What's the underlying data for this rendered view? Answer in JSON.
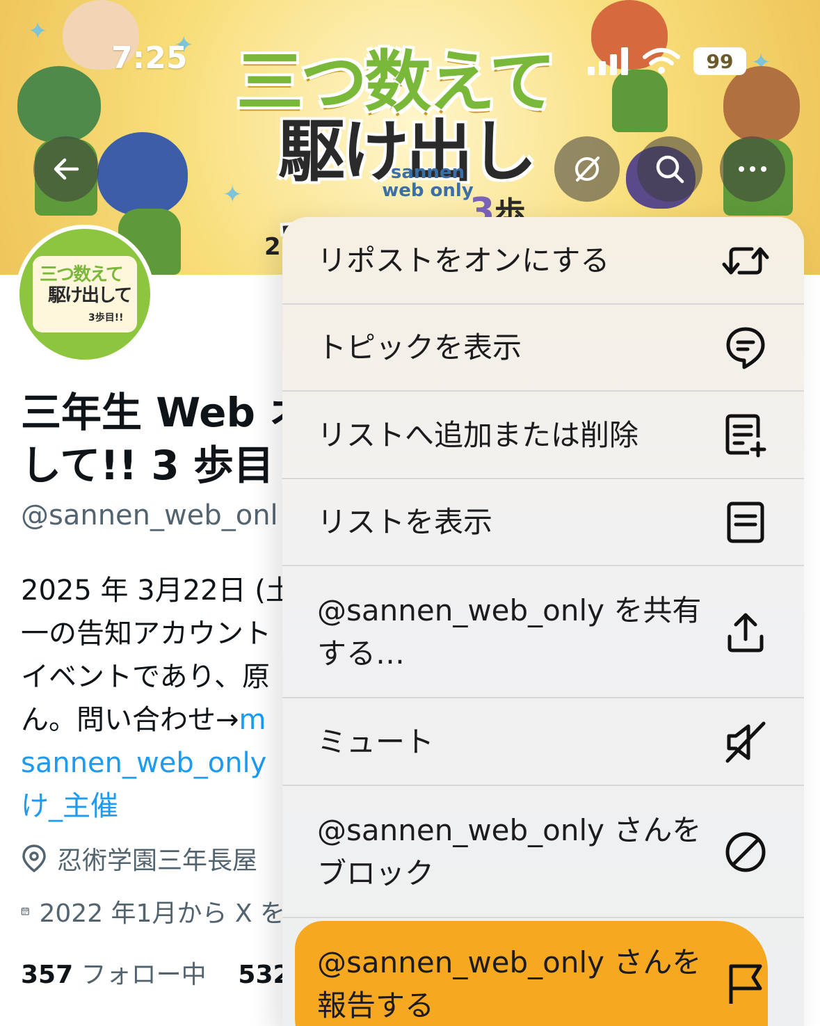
{
  "status_bar": {
    "time": "7:25",
    "battery": "99"
  },
  "banner": {
    "logo_line1": "三つ数えて",
    "logo_line2": "駆け出して",
    "logo_sub": "sannen web only",
    "logo_step_num": "3",
    "logo_step_text": "歩目!!",
    "bottom_text": "2"
  },
  "avatar": {
    "line1": "三つ数えて",
    "line2": "駆け出して",
    "line3": "3歩目!!"
  },
  "profile": {
    "name_line1": "三年生 Web オ",
    "name_line2": "して!! 3 歩目",
    "handle": "@sannen_web_onl",
    "bio_lines": [
      "2025 年 3月22日 (土",
      "一の告知アカウント",
      "イベントであり、原",
      "ん。問い合わせ→"
    ],
    "bio_link1": "m",
    "bio_link2": "sannen_web_only",
    "bio_link3": "け_主催",
    "location": "忍術学園三年長屋",
    "joined": "2022 年1月から X を",
    "following_count": "357",
    "following_label": "フォロー中",
    "followers_count": "532"
  },
  "menu": {
    "items": [
      {
        "label": "リポストをオンにする",
        "icon": "repost-icon"
      },
      {
        "label": "トピックを表示",
        "icon": "topic-icon"
      },
      {
        "label": "リストへ追加または削除",
        "icon": "list-add-icon"
      },
      {
        "label": "リストを表示",
        "icon": "list-icon"
      },
      {
        "label": "@sannen_web_only を共有する…",
        "icon": "share-icon"
      },
      {
        "label": "ミュート",
        "icon": "mute-icon"
      },
      {
        "label": "@sannen_web_only さんをブロック",
        "icon": "block-icon"
      },
      {
        "label": "@sannen_web_only さんを報告する",
        "icon": "flag-icon"
      }
    ]
  },
  "colors": {
    "link": "#1d9bf0",
    "highlight": "#f6a315",
    "avatar_green": "#8cc63f"
  }
}
